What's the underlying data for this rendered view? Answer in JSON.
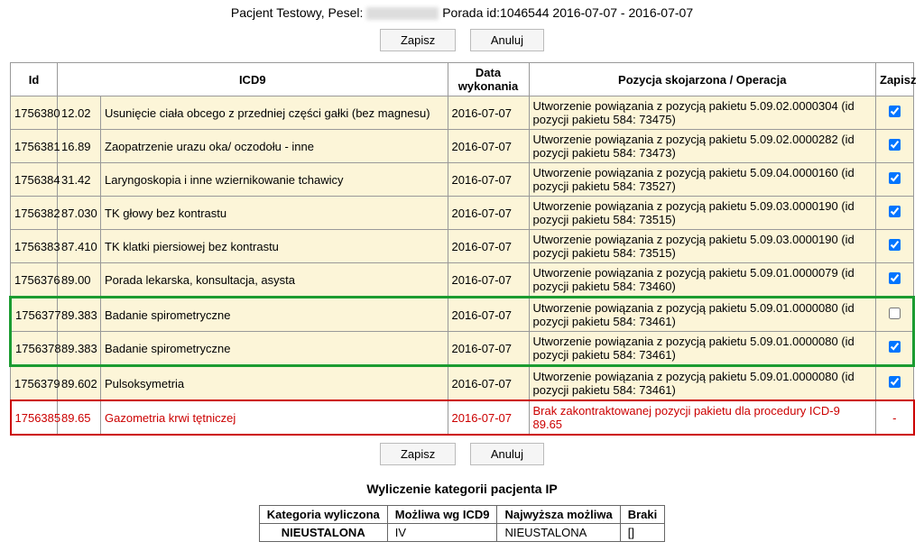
{
  "header": {
    "prefix": "Pacjent Testowy, Pesel:",
    "suffix": "Porada id:1046544 2016-07-07 - 2016-07-07"
  },
  "buttons": {
    "save": "Zapisz",
    "cancel": "Anuluj"
  },
  "table": {
    "headers": {
      "id": "Id",
      "icd9": "ICD9",
      "date": "Data wykonania",
      "op": "Pozycja skojarzona / Operacja",
      "save": "Zapisz"
    },
    "rows": [
      {
        "id": "1756380",
        "code": "12.02",
        "desc": "Usunięcie ciała obcego z przedniej części gałki (bez magnesu)",
        "date": "2016-07-07",
        "op": "Utworzenie powiązania z pozycją pakietu 5.09.02.0000304 (id pozycji pakietu 584: 73475)",
        "style": "yellow",
        "save": "checked"
      },
      {
        "id": "1756381",
        "code": "16.89",
        "desc": "Zaopatrzenie urazu oka/ oczodołu - inne",
        "date": "2016-07-07",
        "op": "Utworzenie powiązania z pozycją pakietu 5.09.02.0000282 (id pozycji pakietu 584: 73473)",
        "style": "yellow",
        "save": "checked"
      },
      {
        "id": "1756384",
        "code": "31.42",
        "desc": "Laryngoskopia i inne wziernikowanie tchawicy",
        "date": "2016-07-07",
        "op": "Utworzenie powiązania z pozycją pakietu 5.09.04.0000160 (id pozycji pakietu 584: 73527)",
        "style": "yellow",
        "save": "checked"
      },
      {
        "id": "1756382",
        "code": "87.030",
        "desc": "TK głowy bez kontrastu",
        "date": "2016-07-07",
        "op": "Utworzenie powiązania z pozycją pakietu 5.09.03.0000190 (id pozycji pakietu 584: 73515)",
        "style": "yellow",
        "save": "checked"
      },
      {
        "id": "1756383",
        "code": "87.410",
        "desc": "TK klatki piersiowej bez kontrastu",
        "date": "2016-07-07",
        "op": "Utworzenie powiązania z pozycją pakietu 5.09.03.0000190 (id pozycji pakietu 584: 73515)",
        "style": "yellow",
        "save": "checked"
      },
      {
        "id": "1756376",
        "code": "89.00",
        "desc": "Porada lekarska, konsultacja, asysta",
        "date": "2016-07-07",
        "op": "Utworzenie powiązania z pozycją pakietu 5.09.01.0000079 (id pozycji pakietu 584: 73460)",
        "style": "yellow",
        "save": "checked"
      },
      {
        "id": "1756377",
        "code": "89.383",
        "desc": "Badanie spirometryczne",
        "date": "2016-07-07",
        "op": "Utworzenie powiązania z pozycją pakietu 5.09.01.0000080 (id pozycji pakietu 584: 73461)",
        "style": "green-top",
        "save": "unchecked"
      },
      {
        "id": "1756378",
        "code": "89.383",
        "desc": "Badanie spirometryczne",
        "date": "2016-07-07",
        "op": "Utworzenie powiązania z pozycją pakietu 5.09.01.0000080 (id pozycji pakietu 584: 73461)",
        "style": "green-bottom",
        "save": "checked"
      },
      {
        "id": "1756379",
        "code": "89.602",
        "desc": "Pulsoksymetria",
        "date": "2016-07-07",
        "op": "Utworzenie powiązania z pozycją pakietu 5.09.01.0000080 (id pozycji pakietu 584: 73461)",
        "style": "yellow",
        "save": "checked"
      },
      {
        "id": "1756385",
        "code": "89.65",
        "desc": "Gazometria krwi tętniczej",
        "date": "2016-07-07",
        "op": "Brak zakontraktowanej pozycji pakietu dla procedury ICD-9 89.65",
        "style": "red",
        "save": "dash"
      }
    ]
  },
  "summary": {
    "title": "Wyliczenie kategorii pacjenta IP",
    "headers": {
      "cat": "Kategoria wyliczona",
      "possible": "Możliwa wg ICD9",
      "highest": "Najwyższa możliwa",
      "missing": "Braki"
    },
    "row": {
      "cat": "NIEUSTALONA",
      "possible": "IV",
      "highest": "NIEUSTALONA",
      "missing": "[]"
    }
  }
}
